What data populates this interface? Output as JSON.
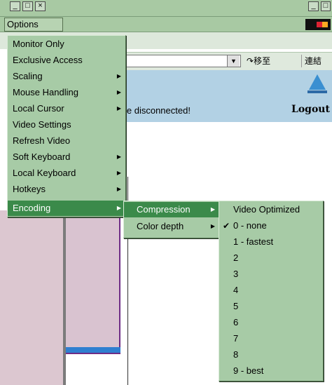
{
  "window": {
    "controls": [
      "_",
      "□",
      "×"
    ],
    "right_controls": [
      "_",
      "□"
    ]
  },
  "options_button": "Options",
  "browser": {
    "goto_label": "移至",
    "links_label": "連結",
    "status_message": "le disconnected!",
    "logout_label": "Logout"
  },
  "main_menu": {
    "items": [
      {
        "label": "Monitor Only",
        "has_submenu": false
      },
      {
        "label": "Exclusive Access",
        "has_submenu": false
      },
      {
        "label": "Scaling",
        "has_submenu": true
      },
      {
        "label": "Mouse Handling",
        "has_submenu": true
      },
      {
        "label": "Local Cursor",
        "has_submenu": true
      },
      {
        "label": "Video Settings",
        "has_submenu": false
      },
      {
        "label": "Refresh Video",
        "has_submenu": false
      },
      {
        "label": "Soft Keyboard",
        "has_submenu": true
      },
      {
        "label": "Local Keyboard",
        "has_submenu": true
      },
      {
        "label": "Hotkeys",
        "has_submenu": true
      },
      {
        "label": "Encoding",
        "has_submenu": true,
        "selected": true
      }
    ]
  },
  "encoding_menu": {
    "items": [
      {
        "label": "Compression",
        "has_submenu": true,
        "selected": true
      },
      {
        "label": "Color depth",
        "has_submenu": true
      }
    ]
  },
  "compression_menu": {
    "items": [
      {
        "label": "Video Optimized",
        "checked": false
      },
      {
        "label": "0 - none",
        "checked": true
      },
      {
        "label": "1 - fastest",
        "checked": false
      },
      {
        "label": "2",
        "checked": false
      },
      {
        "label": "3",
        "checked": false
      },
      {
        "label": "4",
        "checked": false
      },
      {
        "label": "5",
        "checked": false
      },
      {
        "label": "6",
        "checked": false
      },
      {
        "label": "7",
        "checked": false
      },
      {
        "label": "8",
        "checked": false
      },
      {
        "label": "9 - best",
        "checked": false
      }
    ]
  },
  "colors": {
    "menu_bg": "#a7cba6",
    "selected_bg": "#3b8a4a",
    "banner_bg": "#b2d1e4"
  }
}
